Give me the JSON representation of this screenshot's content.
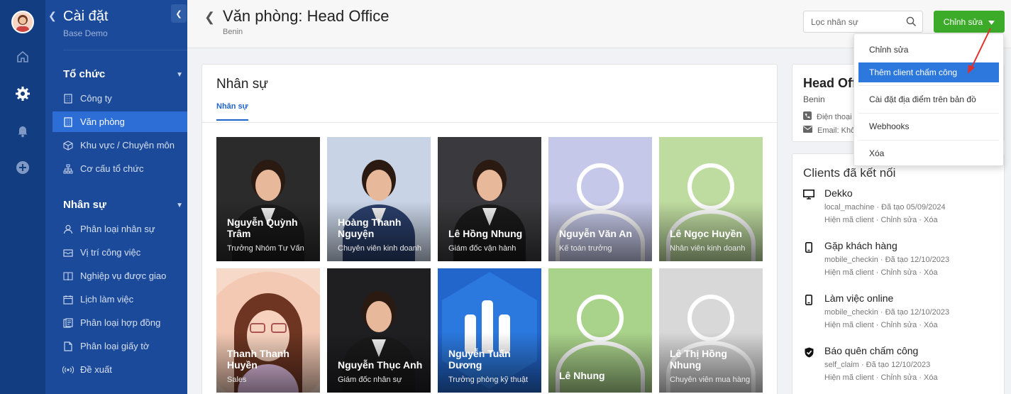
{
  "rail": {
    "icons": [
      "home-icon",
      "gear-icon",
      "bell-icon",
      "add-circle-icon"
    ]
  },
  "sidebar": {
    "title": "Cài đặt",
    "subtitle": "Base Demo",
    "groups": [
      {
        "title": "Tổ chức",
        "items": [
          {
            "label": "Công ty",
            "icon": "building-icon"
          },
          {
            "label": "Văn phòng",
            "icon": "office-icon",
            "active": true
          },
          {
            "label": "Khu vực / Chuyên môn",
            "icon": "cube-icon"
          },
          {
            "label": "Cơ cấu tổ chức",
            "icon": "org-chart-icon"
          }
        ]
      },
      {
        "title": "Nhân sự",
        "items": [
          {
            "label": "Phân loại nhân sự",
            "icon": "user-icon"
          },
          {
            "label": "Vị trí công việc",
            "icon": "inbox-icon"
          },
          {
            "label": "Nghiệp vụ được giao",
            "icon": "book-icon"
          },
          {
            "label": "Lịch làm việc",
            "icon": "calendar-icon"
          },
          {
            "label": "Phân loại hợp đồng",
            "icon": "contract-icon"
          },
          {
            "label": "Phân loại giấy tờ",
            "icon": "document-icon"
          },
          {
            "label": "Đề xuất",
            "icon": "broadcast-icon"
          }
        ]
      }
    ]
  },
  "header": {
    "title": "Văn phòng: Head Office",
    "subtitle": "Benin",
    "search_placeholder": "Lọc nhân sự",
    "edit_label": "Chỉnh sửa"
  },
  "staff_panel": {
    "title": "Nhân sự",
    "tab": "Nhân sự",
    "people": [
      {
        "name": "Nguyễn Quỳnh Trâm",
        "role": "Trưởng Nhóm Tư Vấn",
        "bg": "#2b2b2b"
      },
      {
        "name": "Hoàng Thanh Nguyện",
        "role": "Chuyên viên kinh doanh",
        "bg": "#c8d4e6"
      },
      {
        "name": "Lê Hồng Nhung",
        "role": "Giám đốc vận hành",
        "bg": "#3a3a3e"
      },
      {
        "name": "Nguyễn Văn An",
        "role": "Kế toán trưởng",
        "bg": "#c5c8e8"
      },
      {
        "name": "Lê Ngọc Huyền",
        "role": "Nhân viên kinh doanh",
        "bg": "#bfdca0"
      },
      {
        "name": "Thanh Thanh Huyền",
        "role": "Sales",
        "bg": "#f6d9c8"
      },
      {
        "name": "Nguyễn Thục Anh",
        "role": "Giám đốc nhân sự",
        "bg": "#1f1f22"
      },
      {
        "name": "Nguyễn Tuấn Dương",
        "role": "Trưởng phòng kỹ thuật",
        "bg": "#2266cc"
      },
      {
        "name": "Lê Nhung",
        "role": "",
        "bg": "#a9d28a"
      },
      {
        "name": "Lê Thị Hồng Nhung",
        "role": "Chuyên viên mua hàng",
        "bg": "#d8d8d8"
      }
    ]
  },
  "office_info": {
    "name": "Head Office",
    "location": "Benin",
    "phone_label": "Điện thoại",
    "email_label": "Email: Khô"
  },
  "clients": {
    "title": "Clients đã kết nối",
    "items": [
      {
        "name": "Dekko",
        "icon": "monitor-icon",
        "meta": "local_machine · Đã tạo 05/09/2024",
        "actions": "Hiện mã client · Chỉnh sửa · Xóa"
      },
      {
        "name": "Gặp khách hàng",
        "icon": "mobile-icon",
        "meta": "mobile_checkin · Đã tạo 12/10/2023",
        "actions": "Hiện mã client · Chỉnh sửa · Xóa"
      },
      {
        "name": "Làm việc online",
        "icon": "mobile-icon",
        "meta": "mobile_checkin · Đã tạo 12/10/2023",
        "actions": "Hiện mã client · Chỉnh sửa · Xóa"
      },
      {
        "name": "Báo quên chấm công",
        "icon": "shield-check-icon",
        "meta": "self_claim · Đã tạo 12/10/2023",
        "actions": "Hiện mã client · Chỉnh sửa · Xóa"
      }
    ]
  },
  "dropdown": {
    "items": [
      "Chỉnh sửa",
      "Thêm client chấm công",
      "Cài đặt địa điểm trên bản đồ",
      "Webhooks",
      "Xóa"
    ],
    "highlighted": "Thêm client chấm công"
  },
  "colors": {
    "rail": "#123d80",
    "sidebar": "#1b4a9a",
    "active_item": "#2d6ed6",
    "primary_button": "#3cab2a",
    "highlight": "#2d78dc",
    "annotation_arrow": "#e0302a"
  }
}
